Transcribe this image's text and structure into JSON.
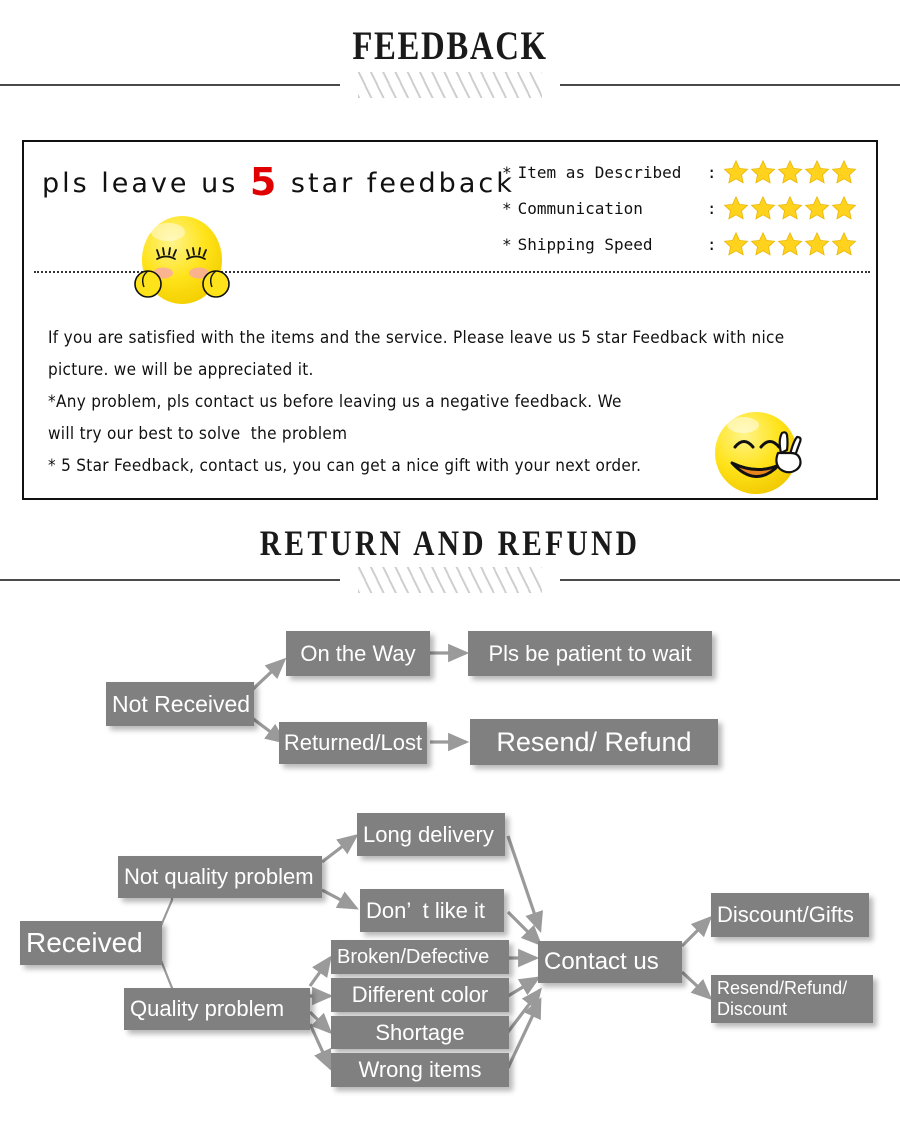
{
  "sections": {
    "feedback_heading": "FEEDBACK",
    "return_heading": "RETURN AND REFUND"
  },
  "feedback": {
    "headline_before": "pls leave us ",
    "headline_number": "5",
    "headline_after": " star feedback",
    "ratings": [
      {
        "bullet": "*",
        "label": "Item as Described",
        "colon": ":",
        "stars": 5
      },
      {
        "bullet": "*",
        "label": "Communication",
        "colon": ":",
        "stars": 5
      },
      {
        "bullet": "*",
        "label": "Shipping Speed",
        "colon": ":",
        "stars": 5
      }
    ],
    "paragraph_lines": [
      "If you are satisfied with the items and the service. Please leave us 5 star Feedback with nice",
      "picture. we will be appreciated it.",
      "*Any problem, pls contact us before leaving us a negative feedback. We",
      "will try our best to solve  the problem",
      "* 5 Star Feedback, contact us, you can get a nice gift with your next order."
    ],
    "star_color": "#FFD21E",
    "accent_red": "#E00000"
  },
  "flowchart_not_received": {
    "nodes": [
      {
        "id": "not-received",
        "label": "Not Received"
      },
      {
        "id": "on-the-way",
        "label": "On the Way"
      },
      {
        "id": "returned-lost",
        "label": "Returned/Lost"
      },
      {
        "id": "pls-wait",
        "label": "Pls be patient to wait"
      },
      {
        "id": "resend-refund",
        "label": "Resend/ Refund"
      }
    ]
  },
  "flowchart_received": {
    "nodes": [
      {
        "id": "received",
        "label": "Received"
      },
      {
        "id": "not-quality",
        "label": "Not quality problem"
      },
      {
        "id": "quality",
        "label": "Quality problem"
      },
      {
        "id": "long-delivery",
        "label": "Long delivery"
      },
      {
        "id": "dont-like-it",
        "label": "Don’  t like it"
      },
      {
        "id": "broken-defective",
        "label": "Broken/Defective"
      },
      {
        "id": "different-color",
        "label": "Different color"
      },
      {
        "id": "shortage",
        "label": "Shortage"
      },
      {
        "id": "wrong-items",
        "label": "Wrong items"
      },
      {
        "id": "contact-us",
        "label": "Contact us"
      },
      {
        "id": "discount-gifts",
        "label": "Discount/Gifts"
      },
      {
        "id": "resend-refund-disc",
        "label": "Resend/Refund/\nDiscount"
      }
    ]
  },
  "colors": {
    "node_fill": "#808080",
    "node_text": "#FFFFFF",
    "rule": "#4A4A4A",
    "border": "#111111"
  }
}
